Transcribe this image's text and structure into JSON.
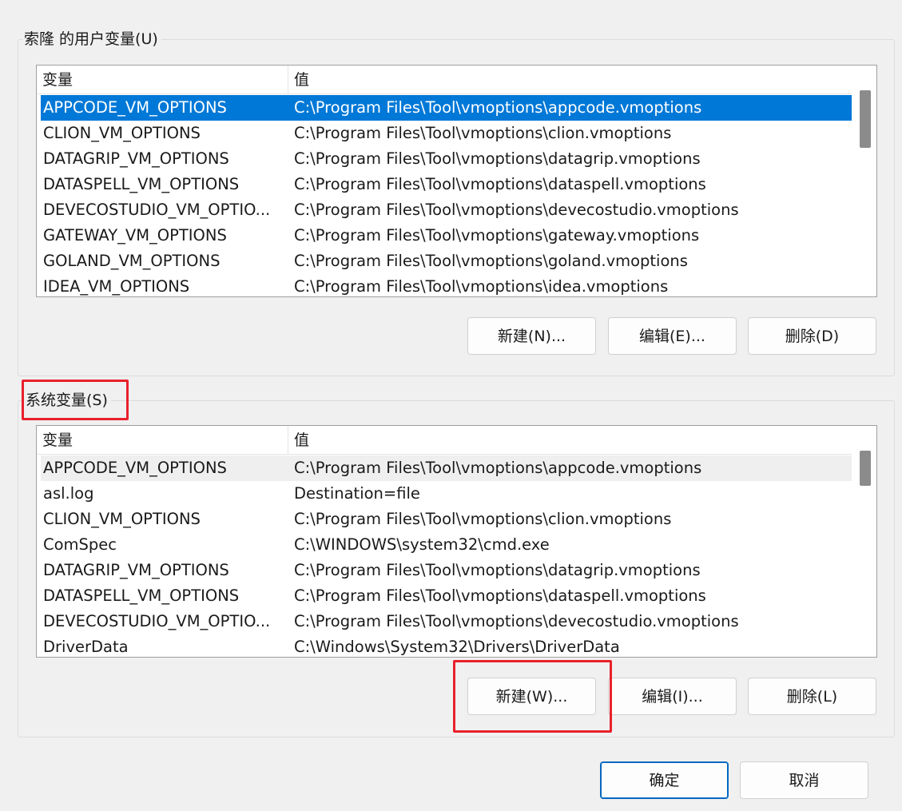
{
  "user_vars": {
    "title": "索隆 的用户变量(U)",
    "col_name": "变量",
    "col_value": "值",
    "rows": [
      {
        "name": "APPCODE_VM_OPTIONS",
        "value": "C:\\Program Files\\Tool\\vmoptions\\appcode.vmoptions"
      },
      {
        "name": "CLION_VM_OPTIONS",
        "value": "C:\\Program Files\\Tool\\vmoptions\\clion.vmoptions"
      },
      {
        "name": "DATAGRIP_VM_OPTIONS",
        "value": "C:\\Program Files\\Tool\\vmoptions\\datagrip.vmoptions"
      },
      {
        "name": "DATASPELL_VM_OPTIONS",
        "value": "C:\\Program Files\\Tool\\vmoptions\\dataspell.vmoptions"
      },
      {
        "name": "DEVECOSTUDIO_VM_OPTIO...",
        "value": "C:\\Program Files\\Tool\\vmoptions\\devecostudio.vmoptions"
      },
      {
        "name": "GATEWAY_VM_OPTIONS",
        "value": "C:\\Program Files\\Tool\\vmoptions\\gateway.vmoptions"
      },
      {
        "name": "GOLAND_VM_OPTIONS",
        "value": "C:\\Program Files\\Tool\\vmoptions\\goland.vmoptions"
      },
      {
        "name": "IDEA_VM_OPTIONS",
        "value": "C:\\Program Files\\Tool\\vmoptions\\idea.vmoptions"
      }
    ],
    "selected_index": 0,
    "buttons": {
      "new": "新建(N)...",
      "edit": "编辑(E)...",
      "delete": "删除(D)"
    }
  },
  "system_vars": {
    "title": "系统变量(S)",
    "col_name": "变量",
    "col_value": "值",
    "rows": [
      {
        "name": "APPCODE_VM_OPTIONS",
        "value": "C:\\Program Files\\Tool\\vmoptions\\appcode.vmoptions"
      },
      {
        "name": "asl.log",
        "value": "Destination=file"
      },
      {
        "name": "CLION_VM_OPTIONS",
        "value": "C:\\Program Files\\Tool\\vmoptions\\clion.vmoptions"
      },
      {
        "name": "ComSpec",
        "value": "C:\\WINDOWS\\system32\\cmd.exe"
      },
      {
        "name": "DATAGRIP_VM_OPTIONS",
        "value": "C:\\Program Files\\Tool\\vmoptions\\datagrip.vmoptions"
      },
      {
        "name": "DATASPELL_VM_OPTIONS",
        "value": "C:\\Program Files\\Tool\\vmoptions\\dataspell.vmoptions"
      },
      {
        "name": "DEVECOSTUDIO_VM_OPTIO...",
        "value": "C:\\Program Files\\Tool\\vmoptions\\devecostudio.vmoptions"
      },
      {
        "name": "DriverData",
        "value": "C:\\Windows\\System32\\Drivers\\DriverData"
      }
    ],
    "hover_index": 0,
    "buttons": {
      "new": "新建(W)...",
      "edit": "编辑(I)...",
      "delete": "删除(L)"
    }
  },
  "dialog_buttons": {
    "ok": "确定",
    "cancel": "取消"
  },
  "colors": {
    "selection": "#0078d7",
    "annotation": "#e8212b",
    "default_button_border": "#0067c0"
  }
}
